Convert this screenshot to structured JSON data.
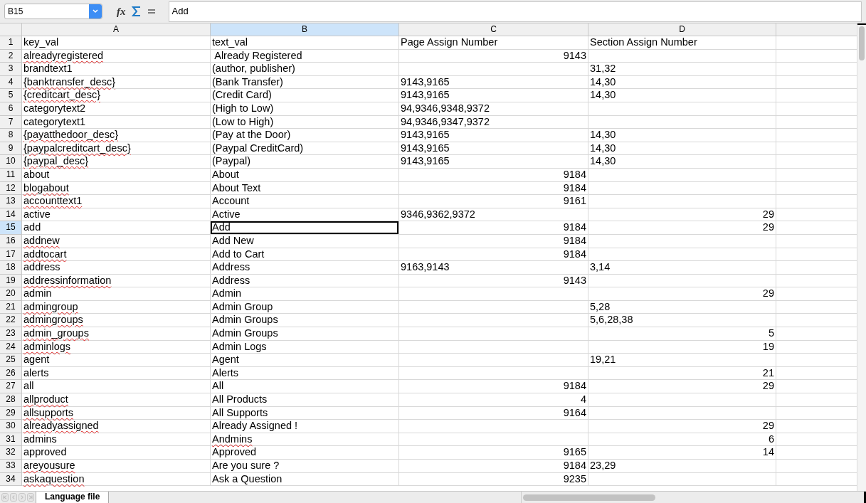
{
  "toolbar": {
    "name_box": "B15",
    "function_button": "fx",
    "formula": "Add"
  },
  "columns": [
    {
      "label": "A",
      "selected": false
    },
    {
      "label": "B",
      "selected": true
    },
    {
      "label": "C",
      "selected": false
    },
    {
      "label": "D",
      "selected": false
    }
  ],
  "rows": [
    {
      "number": "1",
      "selected": false,
      "cells": [
        {
          "text": "key_val",
          "kind": "text"
        },
        {
          "text": "text_val",
          "kind": "text"
        },
        {
          "text": "Page Assign Number",
          "kind": "text"
        },
        {
          "text": "Section Assign Number",
          "kind": "text"
        }
      ]
    },
    {
      "number": "2",
      "selected": false,
      "cells": [
        {
          "text": "alreadyregistered",
          "kind": "text",
          "misspelled": true
        },
        {
          "text": " Already Registered",
          "kind": "text"
        },
        {
          "text": "9143",
          "kind": "number"
        },
        null
      ]
    },
    {
      "number": "3",
      "selected": false,
      "cells": [
        {
          "text": "brandtext1",
          "kind": "text"
        },
        {
          "text": "(author, publisher)",
          "kind": "text"
        },
        null,
        {
          "text": "31,32",
          "kind": "text"
        }
      ]
    },
    {
      "number": "4",
      "selected": false,
      "cells": [
        {
          "text": "{banktransfer_desc}",
          "kind": "text",
          "misspelled": true
        },
        {
          "text": "(Bank Transfer)",
          "kind": "text"
        },
        {
          "text": "9143,9165",
          "kind": "text"
        },
        {
          "text": "14,30",
          "kind": "text"
        }
      ]
    },
    {
      "number": "5",
      "selected": false,
      "cells": [
        {
          "text": "{creditcart_desc}",
          "kind": "text",
          "misspelled": true
        },
        {
          "text": "(Credit Card)",
          "kind": "text"
        },
        {
          "text": "9143,9165",
          "kind": "text"
        },
        {
          "text": "14,30",
          "kind": "text"
        }
      ]
    },
    {
      "number": "6",
      "selected": false,
      "cells": [
        {
          "text": "categorytext2",
          "kind": "text"
        },
        {
          "text": "(High to Low)",
          "kind": "text"
        },
        {
          "text": "94,9346,9348,9372",
          "kind": "text"
        },
        null
      ]
    },
    {
      "number": "7",
      "selected": false,
      "cells": [
        {
          "text": "categorytext1",
          "kind": "text"
        },
        {
          "text": "(Low to High)",
          "kind": "text"
        },
        {
          "text": "94,9346,9347,9372",
          "kind": "text"
        },
        null
      ]
    },
    {
      "number": "8",
      "selected": false,
      "cells": [
        {
          "text": "{payatthedoor_desc}",
          "kind": "text",
          "misspelled": true
        },
        {
          "text": "(Pay at the Door)",
          "kind": "text"
        },
        {
          "text": "9143,9165",
          "kind": "text"
        },
        {
          "text": "14,30",
          "kind": "text"
        }
      ]
    },
    {
      "number": "9",
      "selected": false,
      "cells": [
        {
          "text": "{paypalcreditcart_desc}",
          "kind": "text",
          "misspelled": true
        },
        {
          "text": "(Paypal CreditCard)",
          "kind": "text"
        },
        {
          "text": "9143,9165",
          "kind": "text"
        },
        {
          "text": "14,30",
          "kind": "text"
        }
      ]
    },
    {
      "number": "10",
      "selected": false,
      "cells": [
        {
          "text": "{paypal_desc}",
          "kind": "text",
          "misspelled": true
        },
        {
          "text": "(Paypal)",
          "kind": "text"
        },
        {
          "text": "9143,9165",
          "kind": "text"
        },
        {
          "text": "14,30",
          "kind": "text"
        }
      ]
    },
    {
      "number": "11",
      "selected": false,
      "cells": [
        {
          "text": "about",
          "kind": "text"
        },
        {
          "text": "About",
          "kind": "text"
        },
        {
          "text": "9184",
          "kind": "number"
        },
        null
      ]
    },
    {
      "number": "12",
      "selected": false,
      "cells": [
        {
          "text": "blogabout",
          "kind": "text",
          "misspelled": true
        },
        {
          "text": "About Text",
          "kind": "text"
        },
        {
          "text": "9184",
          "kind": "number"
        },
        null
      ]
    },
    {
      "number": "13",
      "selected": false,
      "cells": [
        {
          "text": "accounttext1",
          "kind": "text",
          "misspelled": true
        },
        {
          "text": "Account",
          "kind": "text"
        },
        {
          "text": "9161",
          "kind": "number"
        },
        null
      ]
    },
    {
      "number": "14",
      "selected": false,
      "cells": [
        {
          "text": "active",
          "kind": "text"
        },
        {
          "text": "Active",
          "kind": "text"
        },
        {
          "text": "9346,9362,9372",
          "kind": "text"
        },
        {
          "text": "29",
          "kind": "number"
        }
      ]
    },
    {
      "number": "15",
      "selected": true,
      "cells": [
        {
          "text": "add",
          "kind": "text"
        },
        {
          "text": "Add",
          "kind": "text"
        },
        {
          "text": "9184",
          "kind": "number"
        },
        {
          "text": "29",
          "kind": "number"
        }
      ]
    },
    {
      "number": "16",
      "selected": false,
      "cells": [
        {
          "text": "addnew",
          "kind": "text",
          "misspelled": true
        },
        {
          "text": "Add New",
          "kind": "text"
        },
        {
          "text": "9184",
          "kind": "number"
        },
        null
      ]
    },
    {
      "number": "17",
      "selected": false,
      "cells": [
        {
          "text": "addtocart",
          "kind": "text",
          "misspelled": true
        },
        {
          "text": "Add to Cart",
          "kind": "text"
        },
        {
          "text": "9184",
          "kind": "number"
        },
        null
      ]
    },
    {
      "number": "18",
      "selected": false,
      "cells": [
        {
          "text": "address",
          "kind": "text"
        },
        {
          "text": "Address",
          "kind": "text"
        },
        {
          "text": "9163,9143",
          "kind": "text"
        },
        {
          "text": "3,14",
          "kind": "text"
        }
      ]
    },
    {
      "number": "19",
      "selected": false,
      "cells": [
        {
          "text": "addressinformation",
          "kind": "text",
          "misspelled": true
        },
        {
          "text": "Address",
          "kind": "text"
        },
        {
          "text": "9143",
          "kind": "number"
        },
        null
      ]
    },
    {
      "number": "20",
      "selected": false,
      "cells": [
        {
          "text": "admin",
          "kind": "text"
        },
        {
          "text": "Admin",
          "kind": "text"
        },
        null,
        {
          "text": "29",
          "kind": "number"
        }
      ]
    },
    {
      "number": "21",
      "selected": false,
      "cells": [
        {
          "text": "admingroup",
          "kind": "text",
          "misspelled": true
        },
        {
          "text": "Admin Group",
          "kind": "text"
        },
        null,
        {
          "text": "5,28",
          "kind": "text"
        }
      ]
    },
    {
      "number": "22",
      "selected": false,
      "cells": [
        {
          "text": "admingroups",
          "kind": "text",
          "misspelled": true
        },
        {
          "text": "Admin Groups",
          "kind": "text"
        },
        null,
        {
          "text": "5,6,28,38",
          "kind": "text"
        }
      ]
    },
    {
      "number": "23",
      "selected": false,
      "cells": [
        {
          "text": "admin_groups",
          "kind": "text",
          "misspelled": true
        },
        {
          "text": "Admin Groups",
          "kind": "text"
        },
        null,
        {
          "text": "5",
          "kind": "number"
        }
      ]
    },
    {
      "number": "24",
      "selected": false,
      "cells": [
        {
          "text": "adminlogs",
          "kind": "text",
          "misspelled": true
        },
        {
          "text": "Admin Logs",
          "kind": "text"
        },
        null,
        {
          "text": "19",
          "kind": "number"
        }
      ]
    },
    {
      "number": "25",
      "selected": false,
      "cells": [
        {
          "text": "agent",
          "kind": "text"
        },
        {
          "text": "Agent",
          "kind": "text"
        },
        null,
        {
          "text": "19,21",
          "kind": "text"
        }
      ]
    },
    {
      "number": "26",
      "selected": false,
      "cells": [
        {
          "text": "alerts",
          "kind": "text"
        },
        {
          "text": "Alerts",
          "kind": "text"
        },
        null,
        {
          "text": "21",
          "kind": "number"
        }
      ]
    },
    {
      "number": "27",
      "selected": false,
      "cells": [
        {
          "text": "all",
          "kind": "text"
        },
        {
          "text": "All",
          "kind": "text"
        },
        {
          "text": "9184",
          "kind": "number"
        },
        {
          "text": "29",
          "kind": "number"
        }
      ]
    },
    {
      "number": "28",
      "selected": false,
      "cells": [
        {
          "text": "allproduct",
          "kind": "text",
          "misspelled": true
        },
        {
          "text": "All Products",
          "kind": "text"
        },
        {
          "text": "4",
          "kind": "number"
        },
        null
      ]
    },
    {
      "number": "29",
      "selected": false,
      "cells": [
        {
          "text": "allsupports",
          "kind": "text",
          "misspelled": true
        },
        {
          "text": "All Supports",
          "kind": "text"
        },
        {
          "text": "9164",
          "kind": "number"
        },
        null
      ]
    },
    {
      "number": "30",
      "selected": false,
      "cells": [
        {
          "text": "alreadyassigned",
          "kind": "text",
          "misspelled": true
        },
        {
          "text": "Already Assigned !",
          "kind": "text"
        },
        null,
        {
          "text": "29",
          "kind": "number"
        }
      ]
    },
    {
      "number": "31",
      "selected": false,
      "cells": [
        {
          "text": "admins",
          "kind": "text"
        },
        {
          "text": "Andmins",
          "kind": "text",
          "misspelled": true
        },
        null,
        {
          "text": "6",
          "kind": "number"
        }
      ]
    },
    {
      "number": "32",
      "selected": false,
      "cells": [
        {
          "text": "approved",
          "kind": "text"
        },
        {
          "text": "Approved",
          "kind": "text"
        },
        {
          "text": "9165",
          "kind": "number"
        },
        {
          "text": "14",
          "kind": "number"
        }
      ]
    },
    {
      "number": "33",
      "selected": false,
      "cells": [
        {
          "text": "areyousure",
          "kind": "text",
          "misspelled": true
        },
        {
          "text": "Are you sure ?",
          "kind": "text"
        },
        {
          "text": "9184",
          "kind": "number"
        },
        {
          "text": "23,29",
          "kind": "text"
        }
      ]
    },
    {
      "number": "34",
      "selected": false,
      "cells": [
        {
          "text": "askaquestion",
          "kind": "text",
          "misspelled": true
        },
        {
          "text": "Ask a Question",
          "kind": "text"
        },
        {
          "text": "9235",
          "kind": "number"
        },
        null
      ]
    }
  ],
  "sheet_tabs": [
    {
      "label": "Language file",
      "selected": true
    }
  ]
}
